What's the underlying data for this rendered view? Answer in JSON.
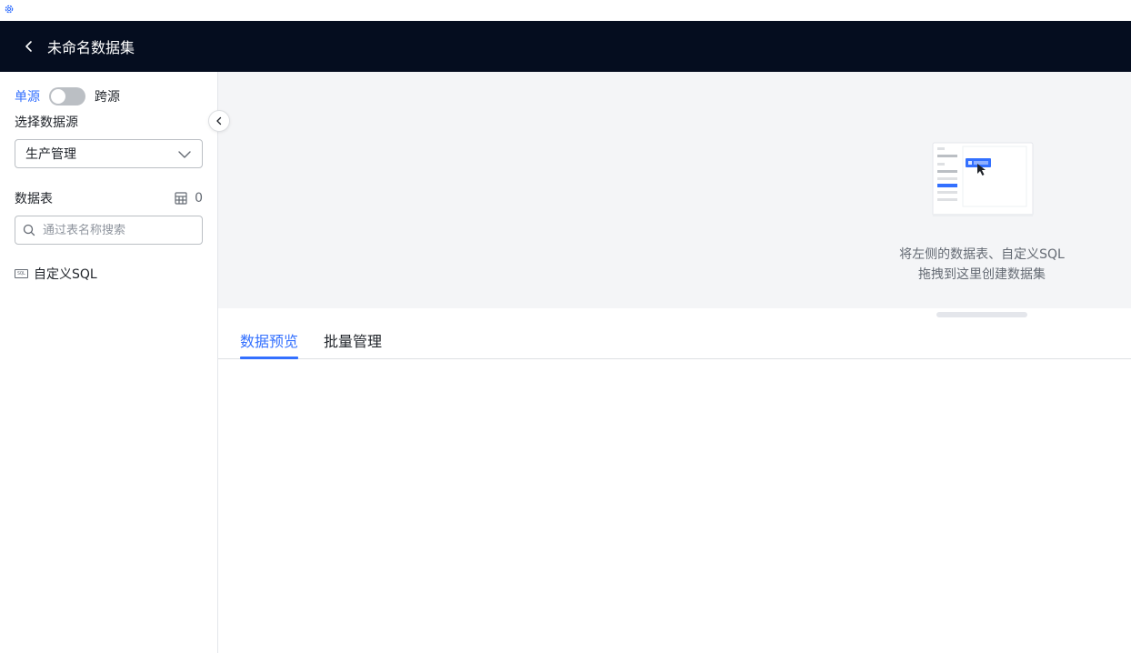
{
  "header": {
    "title": "未命名数据集"
  },
  "sidebar": {
    "mode": {
      "single_label": "单源",
      "cross_label": "跨源",
      "cross_enabled": false
    },
    "datasource_label": "选择数据源",
    "datasource_selected": "生产管理",
    "tables": {
      "label": "数据表",
      "count": "0"
    },
    "search": {
      "placeholder": "通过表名称搜索",
      "value": ""
    },
    "custom_sql": {
      "icon_text": "SQL",
      "label": "自定义SQL"
    }
  },
  "canvas": {
    "empty_line1": "将左侧的数据表、自定义SQL",
    "empty_line2": "拖拽到这里创建数据集"
  },
  "tabs": [
    {
      "label": "数据预览",
      "active": true
    },
    {
      "label": "批量管理",
      "active": false
    }
  ],
  "colors": {
    "accent": "#3370ff",
    "header_bg": "#050d1f",
    "canvas_bg": "#f4f5f7"
  }
}
